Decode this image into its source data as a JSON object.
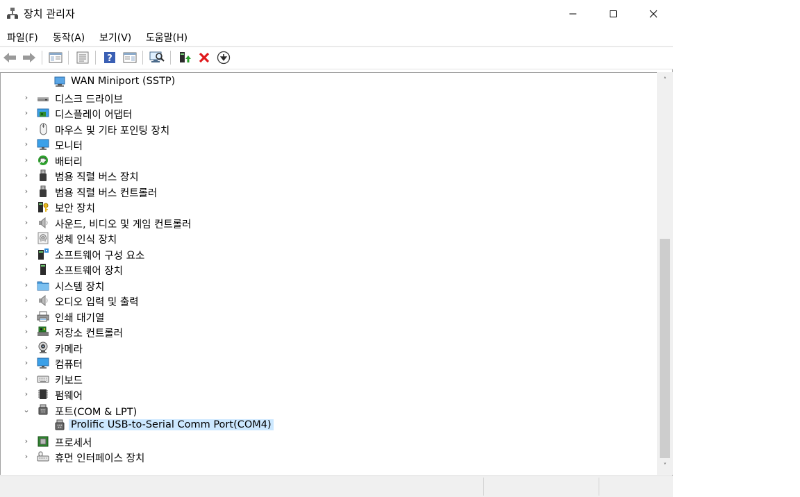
{
  "window": {
    "title": "장치 관리자",
    "minimize_glyph": "—",
    "maximize_glyph": "☐",
    "close_glyph": "✕"
  },
  "menu": [
    "파일(F)",
    "동작(A)",
    "보기(V)",
    "도움말(H)"
  ],
  "toolbar": {
    "buttons": [
      "back-icon",
      "forward-icon",
      "properties-view-icon",
      "list-view-icon",
      "help-icon",
      "details-view-icon",
      "scan-hardware-icon",
      "update-driver-icon",
      "uninstall-icon",
      "disable-device-icon"
    ]
  },
  "tree": {
    "items": [
      {
        "label": "WAN Miniport (SSTP)",
        "level": 2,
        "expander": "",
        "icon": "network-adapter-icon",
        "selected": false
      },
      {
        "label": "디스크 드라이브",
        "level": 1,
        "expander": "›",
        "icon": "disk-drive-icon",
        "selected": false
      },
      {
        "label": "디스플레이 어댑터",
        "level": 1,
        "expander": "›",
        "icon": "display-adapter-icon",
        "selected": false
      },
      {
        "label": "마우스 및 기타 포인팅 장치",
        "level": 1,
        "expander": "›",
        "icon": "mouse-icon",
        "selected": false
      },
      {
        "label": "모니터",
        "level": 1,
        "expander": "›",
        "icon": "monitor-icon",
        "selected": false
      },
      {
        "label": "배터리",
        "level": 1,
        "expander": "›",
        "icon": "battery-icon",
        "selected": false
      },
      {
        "label": "범용 직렬 버스 장치",
        "level": 1,
        "expander": "›",
        "icon": "usb-icon",
        "selected": false
      },
      {
        "label": "범용 직렬 버스 컨트롤러",
        "level": 1,
        "expander": "›",
        "icon": "usb-icon",
        "selected": false
      },
      {
        "label": "보안 장치",
        "level": 1,
        "expander": "›",
        "icon": "security-key-icon",
        "selected": false
      },
      {
        "label": "사운드, 비디오 및 게임 컨트롤러",
        "level": 1,
        "expander": "›",
        "icon": "speaker-icon",
        "selected": false
      },
      {
        "label": "생체 인식 장치",
        "level": 1,
        "expander": "›",
        "icon": "fingerprint-icon",
        "selected": false
      },
      {
        "label": "소프트웨어 구성 요소",
        "level": 1,
        "expander": "›",
        "icon": "software-component-icon",
        "selected": false
      },
      {
        "label": "소프트웨어 장치",
        "level": 1,
        "expander": "›",
        "icon": "software-device-icon",
        "selected": false
      },
      {
        "label": "시스템 장치",
        "level": 1,
        "expander": "›",
        "icon": "system-folder-icon",
        "selected": false
      },
      {
        "label": "오디오 입력 및 출력",
        "level": 1,
        "expander": "›",
        "icon": "speaker-icon",
        "selected": false
      },
      {
        "label": "인쇄 대기열",
        "level": 1,
        "expander": "›",
        "icon": "printer-icon",
        "selected": false
      },
      {
        "label": "저장소 컨트롤러",
        "level": 1,
        "expander": "›",
        "icon": "storage-controller-icon",
        "selected": false
      },
      {
        "label": "카메라",
        "level": 1,
        "expander": "›",
        "icon": "camera-icon",
        "selected": false
      },
      {
        "label": "컴퓨터",
        "level": 1,
        "expander": "›",
        "icon": "computer-icon",
        "selected": false
      },
      {
        "label": "키보드",
        "level": 1,
        "expander": "›",
        "icon": "keyboard-icon",
        "selected": false
      },
      {
        "label": "펌웨어",
        "level": 1,
        "expander": "›",
        "icon": "firmware-icon",
        "selected": false
      },
      {
        "label": "포트(COM & LPT)",
        "level": 1,
        "expander": "⌄",
        "icon": "port-icon",
        "selected": false
      },
      {
        "label": "Prolific USB-to-Serial Comm Port(COM4)",
        "level": 2,
        "expander": "",
        "icon": "port-icon",
        "selected": true
      },
      {
        "label": "프로세서",
        "level": 1,
        "expander": "›",
        "icon": "processor-icon",
        "selected": false
      },
      {
        "label": "휴먼 인터페이스 장치",
        "level": 1,
        "expander": "›",
        "icon": "hid-icon",
        "selected": false
      }
    ]
  },
  "scrollbar": {
    "up_glyph": "˄",
    "down_glyph": "˅"
  },
  "colors": {
    "selection": "#cce8ff",
    "monitor_blue": "#2f8ad8",
    "uninstall_red": "#e0181b",
    "update_green": "#2ca02c"
  }
}
